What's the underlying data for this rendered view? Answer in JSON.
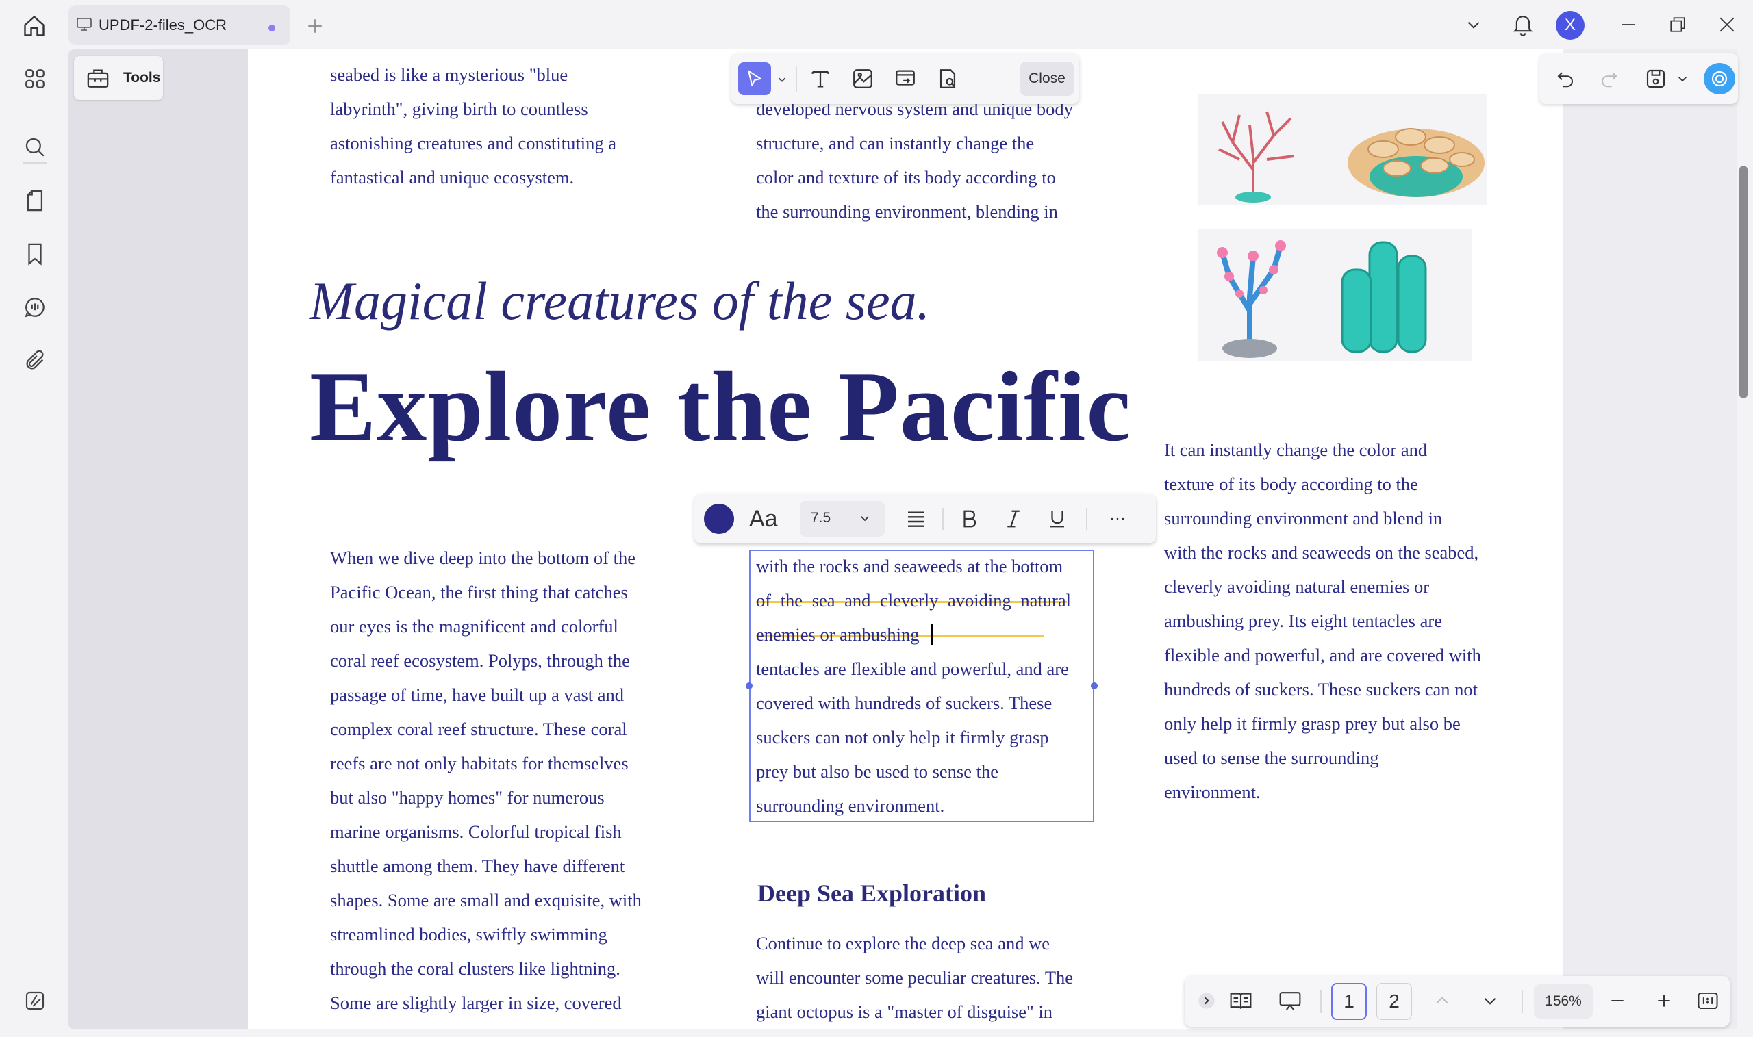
{
  "app": {
    "tab_title": "UPDF-2-files_OCR",
    "avatar_letter": "X",
    "accent": "#6b73ee"
  },
  "left_panel": {
    "tools_label": "Tools"
  },
  "edit_toolbar": {
    "close_label": "Close"
  },
  "format_toolbar": {
    "font_icon_label": "Aa",
    "font_size": "7.5",
    "text_color": "#2b2a86",
    "more_label": "···"
  },
  "page_nav": {
    "current_page": "1",
    "next_page": "2",
    "zoom": "156%"
  },
  "document": {
    "subtitle": "Magical creatures of the sea.",
    "headline": "Explore the Pacific",
    "top_left_lines": [
      "seabed is like a mysterious \"blue",
      "labyrinth\", giving birth to countless",
      "astonishing creatures and constituting a",
      "fantastical and unique ecosystem."
    ],
    "top_middle_lines": [
      "developed nervous system and unique body",
      "structure, and can instantly change the",
      "color and texture of its body according to",
      "the surrounding environment, blending in"
    ],
    "left_column_lines": [
      "When we dive deep into the bottom of the",
      "Pacific Ocean, the first thing that catches",
      "our eyes is the magnificent and colorful",
      "coral reef ecosystem. Polyps, through the",
      "passage of time, have built up a vast and",
      "complex coral reef structure. These coral",
      "reefs are not only habitats for themselves",
      "but also \"happy homes\" for numerous",
      "marine organisms. Colorful tropical fish",
      "shuttle among them. They have different",
      "shapes. Some are small and exquisite, with",
      "streamlined bodies, swiftly swimming",
      "through the coral clusters like lightning.",
      "Some are slightly larger in size, covered"
    ],
    "edit_box_lines": [
      "with the rocks and seaweeds at the bottom",
      "of the sea and cleverly avoiding natural",
      "enemies or ambushing",
      "tentacles are flexible and powerful, and are",
      "covered with hundreds of suckers. These",
      "suckers can not only help it firmly grasp",
      "prey but also be used to sense the",
      "surrounding environment."
    ],
    "right_column_lines": [
      "It can instantly change the color and",
      "texture of its body according to the",
      "surrounding environment and blend in",
      "with the rocks and seaweeds on the seabed,",
      "cleverly avoiding natural enemies or",
      "ambushing prey. Its eight tentacles are",
      "flexible and powerful, and are covered with",
      "hundreds of suckers. These suckers can not",
      "only help it firmly grasp prey but also be",
      "used to sense the surrounding",
      "environment."
    ],
    "deep_sea_heading": "Deep Sea Exploration",
    "deep_sea_lines": [
      "Continue to explore the deep sea and we",
      "will encounter some peculiar creatures. The",
      "giant octopus is a \"master of disguise\" in"
    ]
  }
}
